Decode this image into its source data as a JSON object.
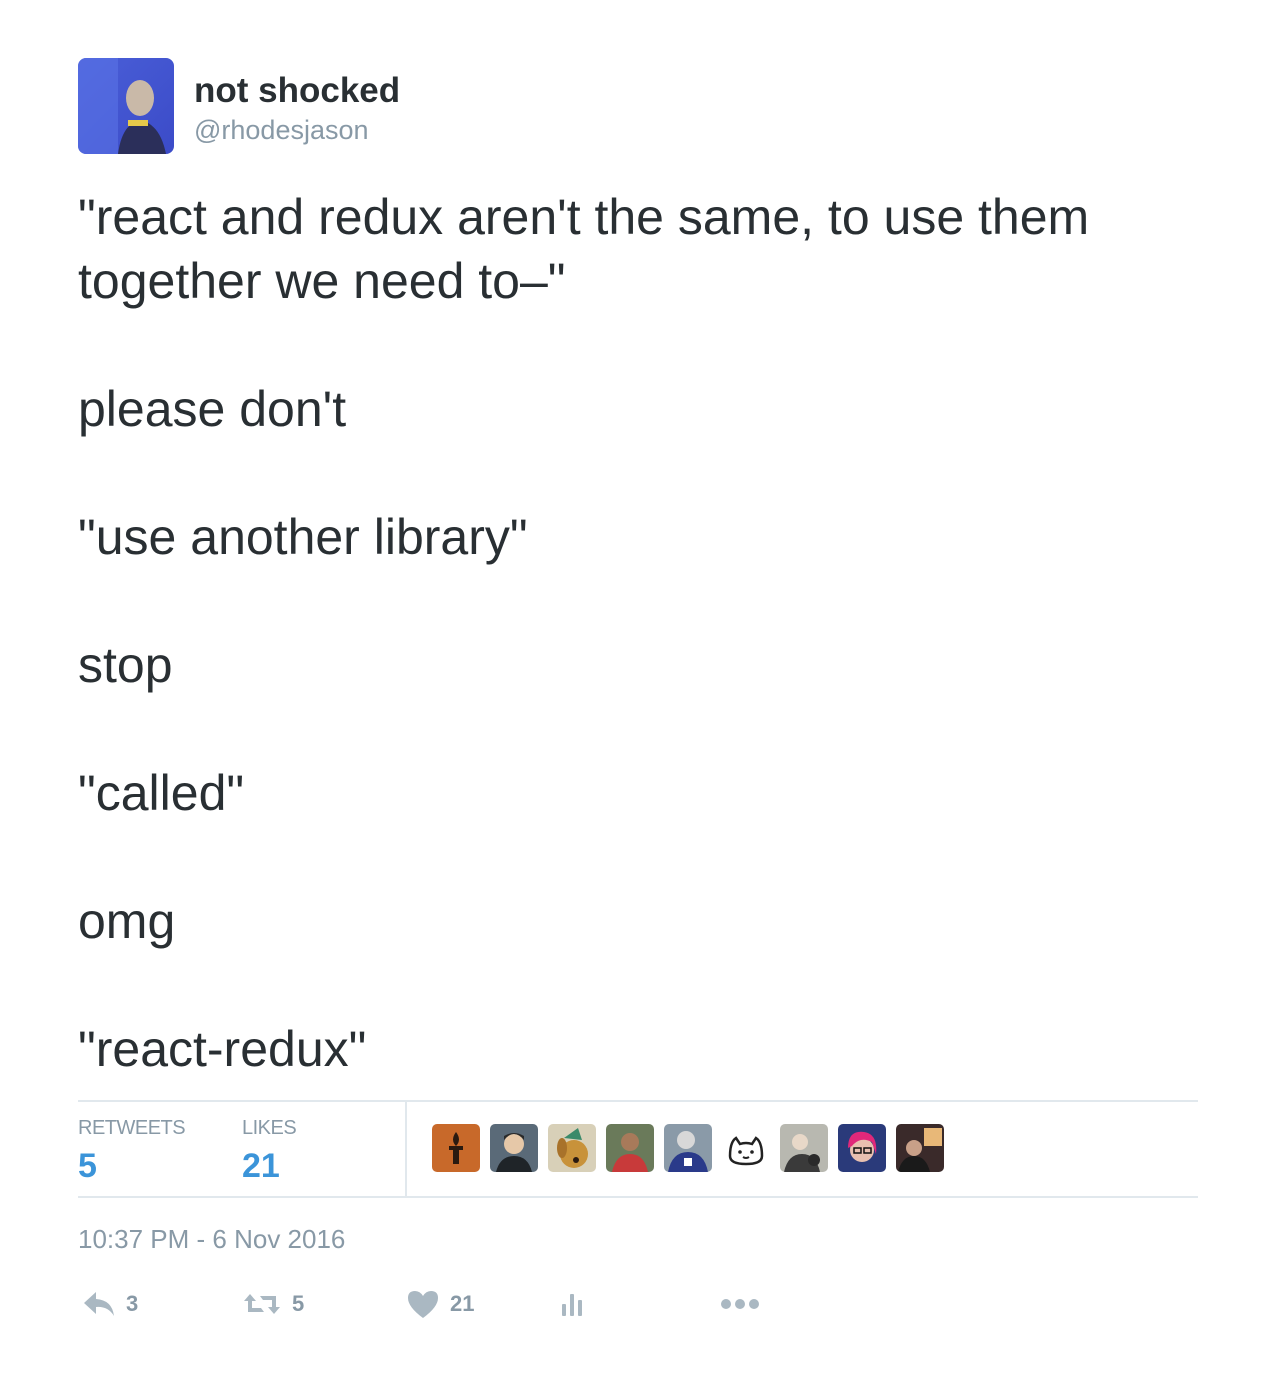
{
  "author": {
    "display_name": "not shocked",
    "handle": "@rhodesjason"
  },
  "tweet": {
    "lines": [
      "\"react and redux aren't the same, to use them together we need to–\"",
      "please don't",
      "\"use another library\"",
      "stop",
      "\"called\"",
      "omg",
      "\"react-redux\""
    ]
  },
  "stats": {
    "retweets_label": "RETWEETS",
    "retweets_count": "5",
    "likes_label": "LIKES",
    "likes_count": "21"
  },
  "timestamp": "10:37 PM - 6 Nov 2016",
  "actions": {
    "reply_count": "3",
    "retweet_count": "5",
    "like_count": "21"
  },
  "colors": {
    "accent": "#3b94d9",
    "muted": "#8899a6",
    "text": "#292f33",
    "divider": "#e1e8ed"
  }
}
